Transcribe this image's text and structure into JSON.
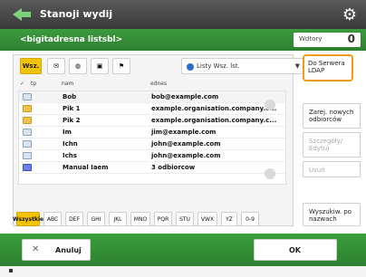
{
  "header": {
    "title": "Stanoji wydij"
  },
  "subheader": {
    "label": "<bigitadresna listsbl>",
    "selected_label": "Wdtory",
    "selected_count": "0"
  },
  "filters": {
    "all_label": "Wsz.",
    "dropdown_value": "Listy Wsz. lst."
  },
  "table": {
    "headers": [
      "tp",
      "nam",
      "ednes"
    ],
    "rows": [
      {
        "type": "email",
        "name": "Bob",
        "email": "bob@example.com"
      },
      {
        "type": "group",
        "name": "Pik 1",
        "email": "example.organisation.company.c..."
      },
      {
        "type": "group",
        "name": "Pik 2",
        "email": "example.organisation.company.c..."
      },
      {
        "type": "email",
        "name": "Im",
        "email": "jim@example.com"
      },
      {
        "type": "email",
        "name": "Ichn",
        "email": "john@example.com"
      },
      {
        "type": "email",
        "name": "Ichs",
        "email": "john@example.com"
      },
      {
        "type": "shared",
        "name": "Manual Iaem",
        "email": "3 odbiorcow"
      }
    ]
  },
  "right_buttons": {
    "ldap": "Do Serwera LDAP",
    "btn1": "Zarej. nowych odbiorców",
    "btn2": "Szczegóły/ Edytuj",
    "btn3": "Usuń",
    "search": "Wyszukiw. po nazwach"
  },
  "alphabet": {
    "items": [
      "Wszystkie",
      "ABC",
      "DEF",
      "GHI",
      "JKL",
      "MNO",
      "PQR",
      "STU",
      "VWX",
      "YZ",
      "0-9"
    ],
    "active_index": 0
  },
  "actions": {
    "cancel": "Anuluj",
    "ok": "OK"
  },
  "icons": {
    "app_icon": "arrow-icon",
    "settings": "gear-icon",
    "email": "envelope-icon",
    "group": "group-icon",
    "shared": "shared-icon"
  },
  "colors": {
    "accent_green": "#2f8f31",
    "highlight_yellow": "#f3c300",
    "outline_orange": "#f39c12"
  }
}
